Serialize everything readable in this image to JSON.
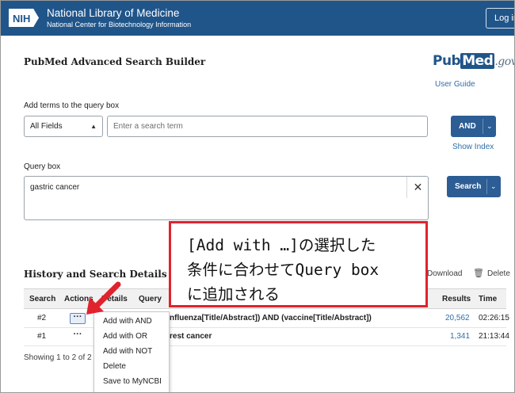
{
  "header": {
    "logo_text": "NIH",
    "org_name": "National Library of Medicine",
    "org_subtitle": "National Center for Biotechnology Information",
    "login_label": "Log in"
  },
  "page": {
    "title": "PubMed Advanced Search Builder",
    "brand_pub": "Pub",
    "brand_med": "Med",
    "brand_gov": ".gov",
    "user_guide": "User Guide"
  },
  "builder": {
    "add_terms_label": "Add terms to the query box",
    "field_value": "All Fields",
    "term_placeholder": "Enter a search term",
    "and_label": "AND",
    "show_index": "Show Index",
    "query_label": "Query box",
    "query_value": "gastric cancer",
    "search_label": "Search"
  },
  "history": {
    "title": "History and Search Details",
    "download_label": "Download",
    "delete_label": "Delete",
    "columns": [
      "Search",
      "Actions",
      "Details",
      "Query",
      "Results",
      "Time"
    ],
    "rows": [
      {
        "search": "#2",
        "query": "nfluenza[Title/Abstract]) AND (vaccine[Title/Abstract])",
        "results": "20,562",
        "time": "02:26:15"
      },
      {
        "search": "#1",
        "query": "rest cancer",
        "results": "1,341",
        "time": "21:13:44"
      }
    ],
    "showing": "Showing 1 to 2 of 2"
  },
  "actions_menu": {
    "items": [
      "Add with AND",
      "Add with OR",
      "Add with NOT",
      "Delete",
      "Save to MyNCBI"
    ]
  },
  "annotation": {
    "lines": [
      "[Add with …]の選択した",
      "条件に合わせてQuery box",
      "に追加される"
    ],
    "border_color": "#e0232d"
  },
  "colors": {
    "header_bg": "#20558a",
    "primary_button": "#2c5d94",
    "link": "#2f6ea8",
    "arrow": "#e0232d"
  }
}
